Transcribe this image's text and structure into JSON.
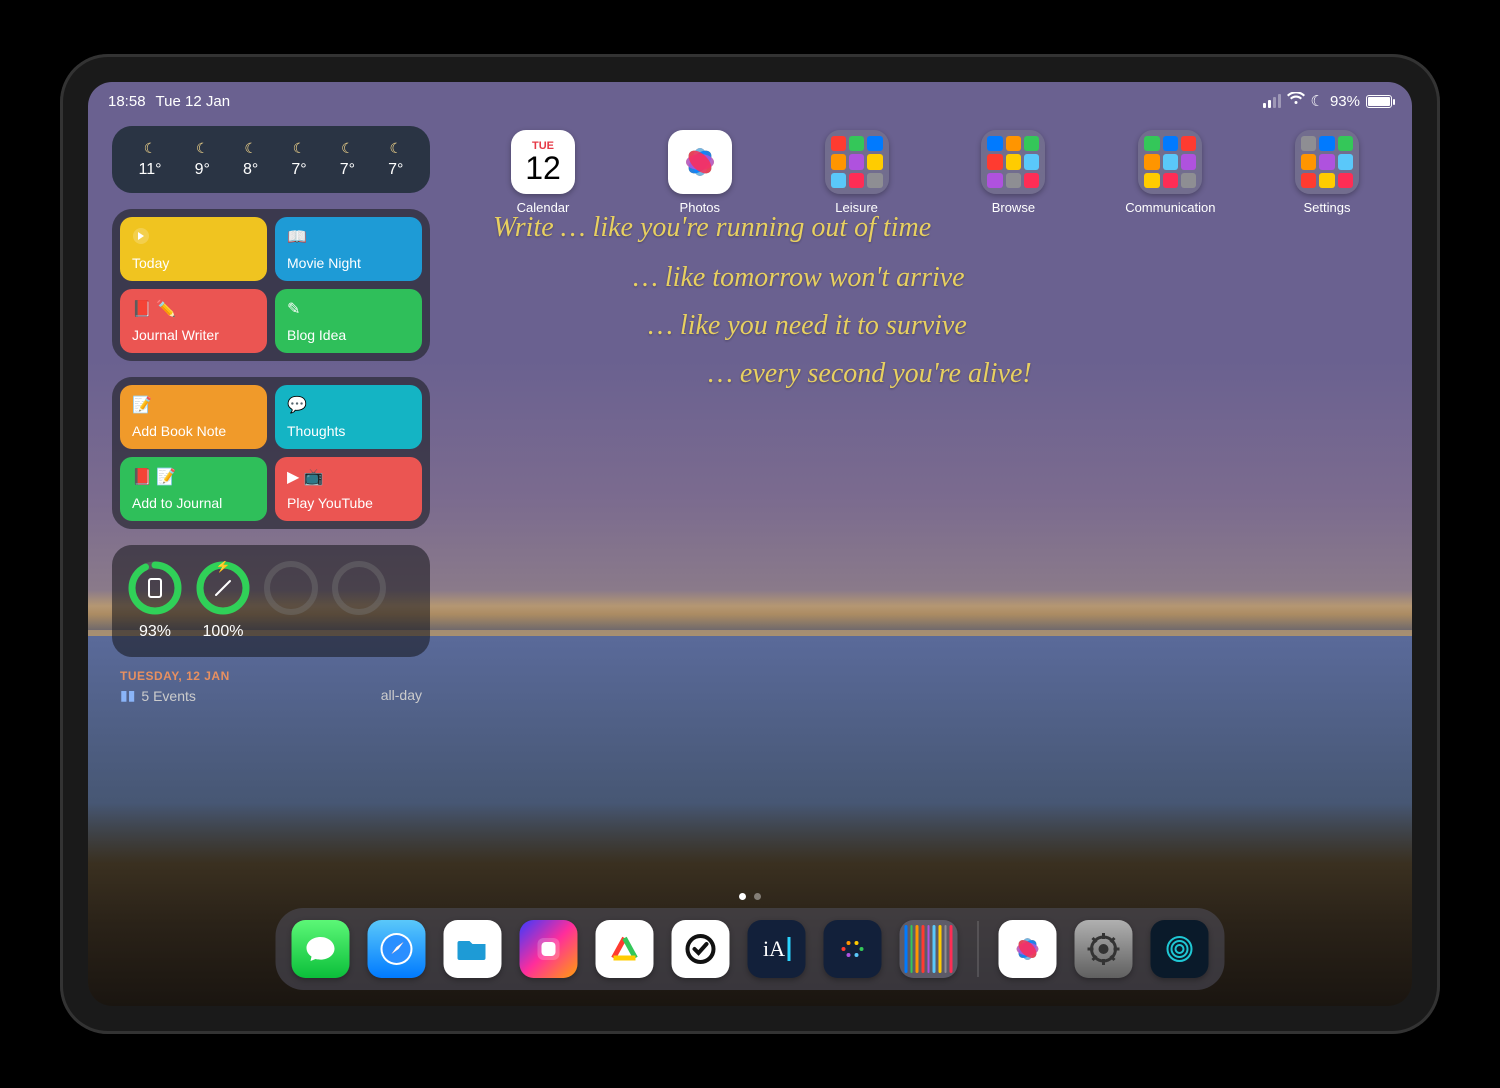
{
  "status": {
    "time": "18:58",
    "date_short": "Tue 12 Jan",
    "battery_percent": "93%"
  },
  "weather": {
    "forecast": [
      {
        "temp": "11°"
      },
      {
        "temp": "9°"
      },
      {
        "temp": "8°"
      },
      {
        "temp": "7°"
      },
      {
        "temp": "7°"
      },
      {
        "temp": "7°"
      }
    ]
  },
  "shortcuts_a": [
    {
      "label": "Today",
      "color": "#f0c420",
      "icon": "run-icon"
    },
    {
      "label": "Movie Night",
      "color": "#1e9bd6",
      "icon": "book-icon"
    },
    {
      "label": "Journal Writer",
      "color": "#eb5552",
      "icon": "pencil-icon"
    },
    {
      "label": "Blog Idea",
      "color": "#2fbf5a",
      "icon": "edit-icon"
    }
  ],
  "shortcuts_b": [
    {
      "label": "Add Book Note",
      "color": "#f09a2a",
      "icon": "note-icon"
    },
    {
      "label": "Thoughts",
      "color": "#14b4c4",
      "icon": "chat-icon"
    },
    {
      "label": "Add to Journal",
      "color": "#2fbf5a",
      "icon": "journal-icon"
    },
    {
      "label": "Play YouTube",
      "color": "#eb5552",
      "icon": "play-icon"
    }
  ],
  "battery_widget": {
    "devices": [
      {
        "name": "ipad",
        "percent": "93%",
        "value": 93,
        "charging": false
      },
      {
        "name": "pencil",
        "percent": "100%",
        "value": 100,
        "charging": true
      }
    ]
  },
  "calendar_peek": {
    "heading": "TUESDAY, 12 JAN",
    "row_left": "5 Events",
    "row_right": "all-day"
  },
  "apps": [
    {
      "label": "Calendar",
      "type": "calendar",
      "day": "TUE",
      "num": "12"
    },
    {
      "label": "Photos",
      "type": "photos"
    },
    {
      "label": "Leisure",
      "type": "folder"
    },
    {
      "label": "Browse",
      "type": "folder"
    },
    {
      "label": "Communication",
      "type": "folder"
    },
    {
      "label": "Settings",
      "type": "folder"
    }
  ],
  "handwriting": [
    "Write … like you're running out of time",
    "… like tomorrow won't arrive",
    "… like you need it to survive",
    "… every second you're alive!"
  ],
  "dock": {
    "main": [
      {
        "name": "messages",
        "bg": "linear-gradient(#5cf777,#0bbf3a)",
        "glyph": "💬"
      },
      {
        "name": "safari",
        "bg": "linear-gradient(#3aa9ff,#0060d6)",
        "glyph": "🧭"
      },
      {
        "name": "files",
        "bg": "#fff",
        "glyph": "📁"
      },
      {
        "name": "shortcuts",
        "bg": "linear-gradient(135deg,#ff3b7b,#ff9f0a,#34c759,#0a84ff)",
        "glyph": "◧"
      },
      {
        "name": "agenda",
        "bg": "linear-gradient(135deg,#ff3b30,#ff9f0a,#ffd60a,#34c759)",
        "glyph": "📚"
      },
      {
        "name": "things",
        "bg": "#fff",
        "glyph": "✅"
      },
      {
        "name": "ia-writer",
        "bg": "#12203a",
        "glyph": "iA"
      },
      {
        "name": "halide",
        "bg": "#12203a",
        "glyph": "∘"
      },
      {
        "name": "folder",
        "bg": "rgba(120,120,140,0.55)",
        "glyph": "⊞"
      }
    ],
    "recent": [
      {
        "name": "photos",
        "bg": "#fff",
        "glyph": "✿"
      },
      {
        "name": "settings",
        "bg": "linear-gradient(#9a9a9a,#5a5a5a)",
        "glyph": "⚙"
      },
      {
        "name": "touchid",
        "bg": "#0a1a2a",
        "glyph": "◎"
      }
    ]
  }
}
